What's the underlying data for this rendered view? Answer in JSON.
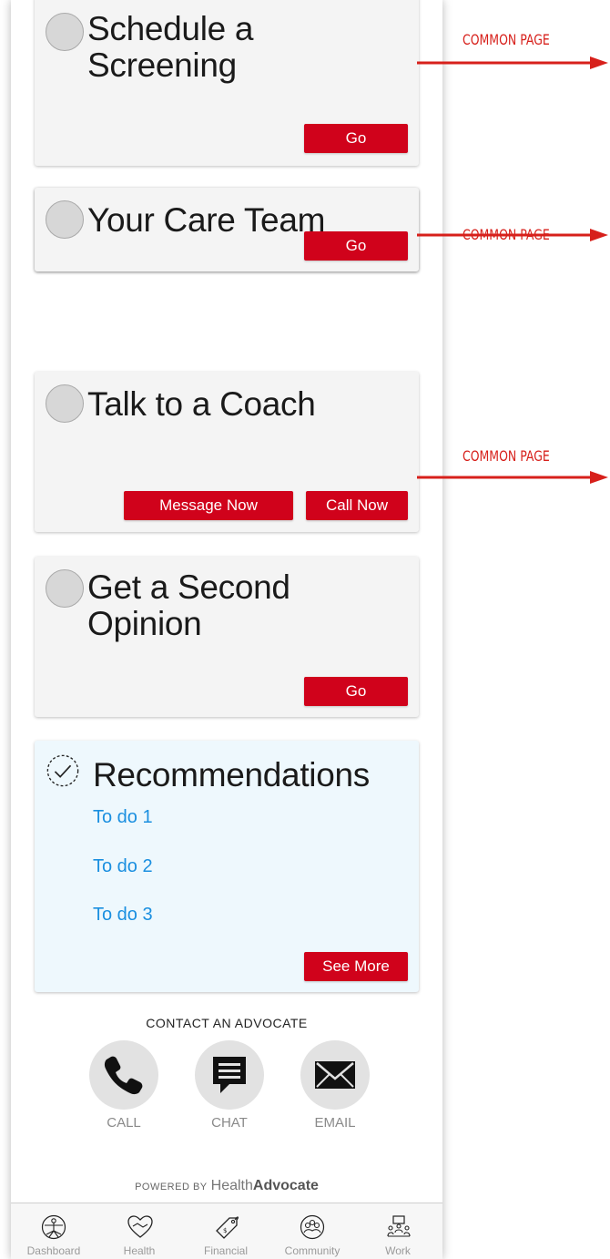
{
  "cards": [
    {
      "title_lines": [
        "Schedule a",
        "Screening"
      ],
      "button": "Go"
    },
    {
      "title_lines": [
        "Your Care Team"
      ],
      "button": "Go"
    },
    {
      "title_lines": [
        "Talk to a Coach"
      ],
      "buttons": [
        "Message Now",
        "Call Now"
      ]
    },
    {
      "title_lines": [
        "Get a Second",
        "Opinion"
      ],
      "button": "Go"
    }
  ],
  "recommendations": {
    "title": "Recommendations",
    "items": [
      "To do 1",
      "To do 2",
      "To do 3"
    ],
    "button": "See More"
  },
  "contact": {
    "title": "CONTACT AN ADVOCATE",
    "actions": [
      {
        "label": "CALL",
        "icon": "phone-icon"
      },
      {
        "label": "CHAT",
        "icon": "chat-icon"
      },
      {
        "label": "EMAIL",
        "icon": "envelope-icon"
      }
    ]
  },
  "powered_by": {
    "prefix": "POWERED BY",
    "brand_light": "Health",
    "brand_bold": "Advocate"
  },
  "tabs": [
    {
      "label": "Dashboard",
      "icon": "vitruvian-icon"
    },
    {
      "label": "Health",
      "icon": "heart-hands-icon"
    },
    {
      "label": "Financial",
      "icon": "price-tag-icon"
    },
    {
      "label": "Community",
      "icon": "people-circle-icon"
    },
    {
      "label": "Work",
      "icon": "meeting-icon"
    }
  ],
  "annotations": [
    "COMMON PAGE",
    "COMMON PAGE",
    "COMMON PAGE"
  ],
  "colors": {
    "accent": "#d0021b",
    "link": "#1a8fe0",
    "annotation": "#d7201b"
  }
}
